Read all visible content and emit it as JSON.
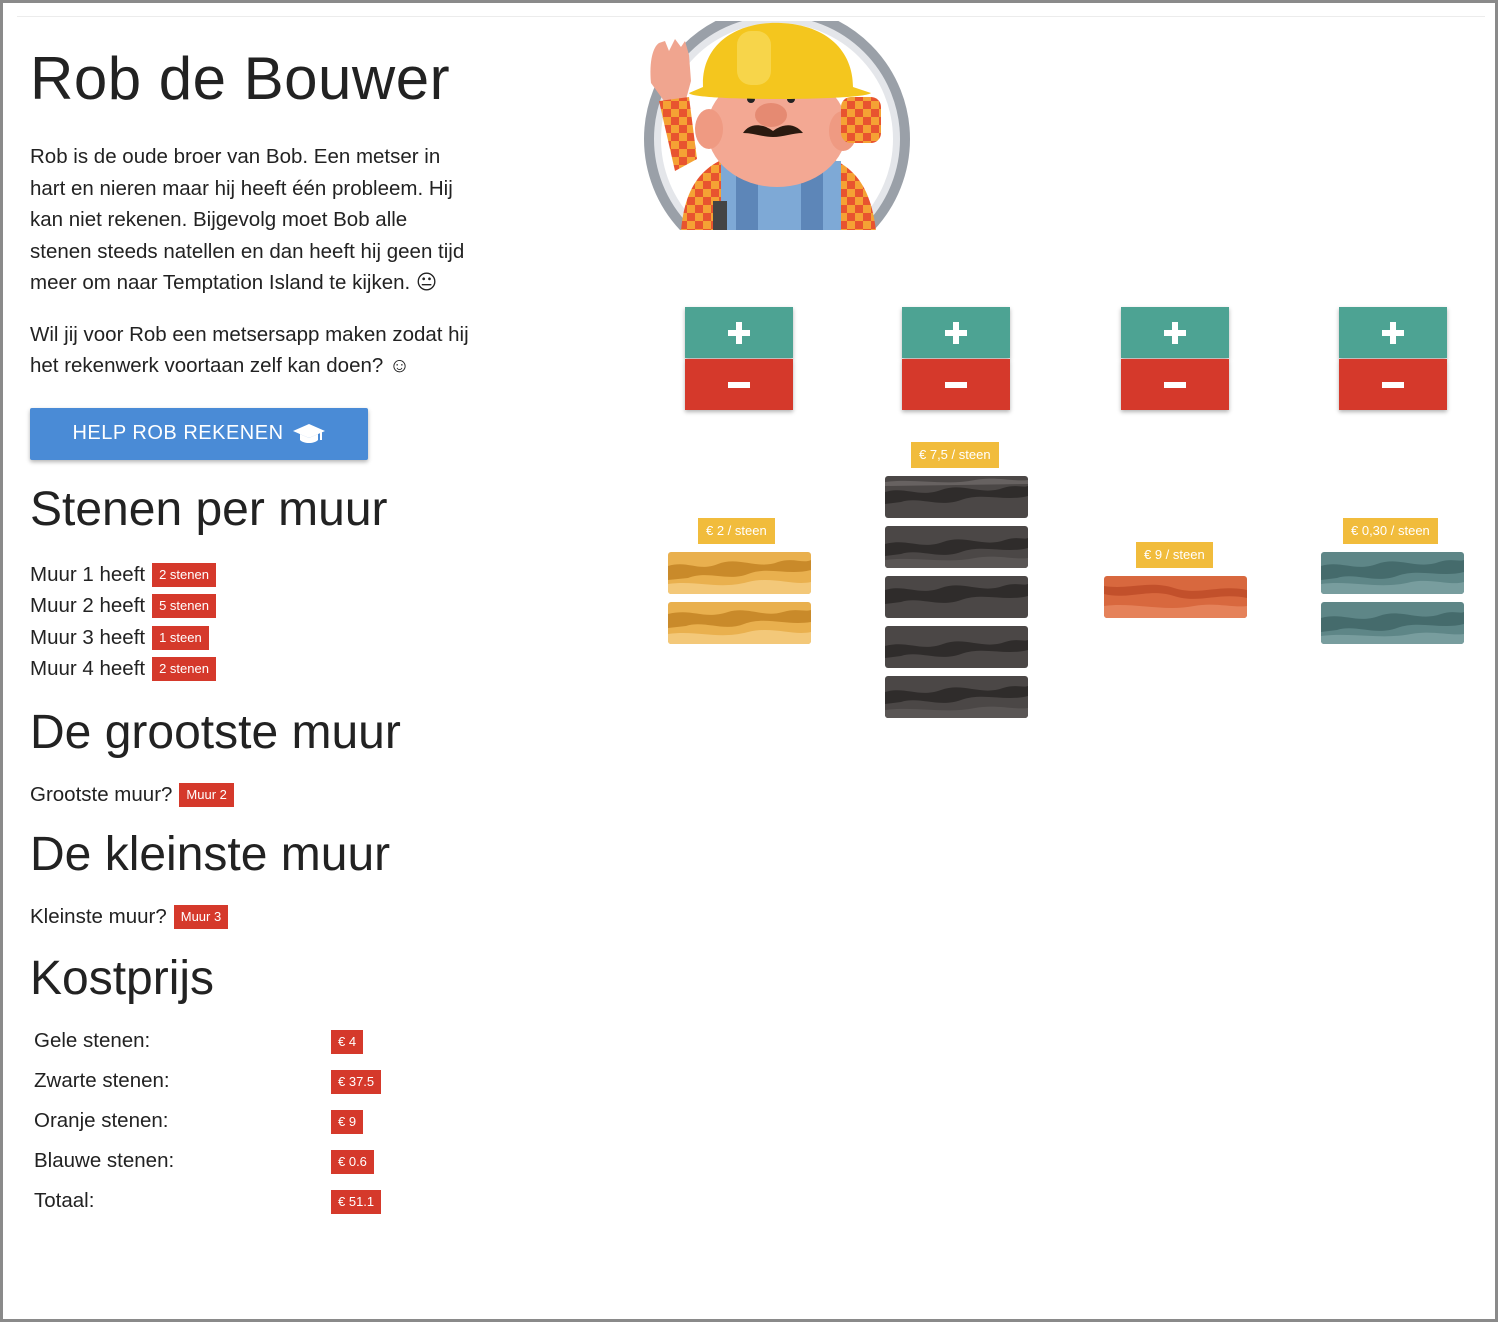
{
  "header": {
    "title": "Rob de Bouwer",
    "intro_1": "Rob is de oude broer van Bob. Een metser in hart en nieren maar hij heeft één probleem. Hij kan niet rekenen. Bijgevolg moet Bob alle stenen steeds natellen en dan heeft hij geen tijd meer om naar Temptation Island te kijken. 😐",
    "intro_2": "Wil jij voor Rob een metsersapp maken zodat hij het rekenwerk voortaan zelf kan doen? ☺",
    "help_button": "HELP ROB REKENEN",
    "help_icon": "graduation-cap-icon"
  },
  "sections": {
    "stenen_per_muur": "Stenen per muur",
    "grootste": "De grootste muur",
    "kleinste": "De kleinste muur",
    "kostprijs": "Kostprijs"
  },
  "walls": [
    {
      "label": "Muur 1 heeft",
      "count": "2 stenen"
    },
    {
      "label": "Muur 2 heeft",
      "count": "5 stenen"
    },
    {
      "label": "Muur 3 heeft",
      "count": "1 steen"
    },
    {
      "label": "Muur 4 heeft",
      "count": "2 stenen"
    }
  ],
  "largest": {
    "question": "Grootste muur?",
    "answer": "Muur 2"
  },
  "smallest": {
    "question": "Kleinste muur?",
    "answer": "Muur 3"
  },
  "costs": [
    {
      "label": "Gele stenen:",
      "value": "€ 4"
    },
    {
      "label": "Zwarte stenen:",
      "value": "€ 37.5"
    },
    {
      "label": "Oranje stenen:",
      "value": "€ 9"
    },
    {
      "label": "Blauwe stenen:",
      "value": "€ 0.6"
    },
    {
      "label": "Totaal:",
      "value": "€ 51.1"
    }
  ],
  "brick_columns": [
    {
      "price": "€ 2 / steen",
      "color": "yellow",
      "bricks": 2
    },
    {
      "price": "€ 7,5 / steen",
      "color": "black",
      "bricks": 5
    },
    {
      "price": "€ 9 / steen",
      "color": "orange",
      "bricks": 1
    },
    {
      "price": "€ 0,30 / steen",
      "color": "blue",
      "bricks": 2
    }
  ],
  "colors": {
    "accent_blue": "#4a8bd6",
    "plus_green": "#4da393",
    "minus_red": "#d5392b",
    "badge_red": "#d5392b",
    "price_yellow": "#f1bc3c"
  }
}
